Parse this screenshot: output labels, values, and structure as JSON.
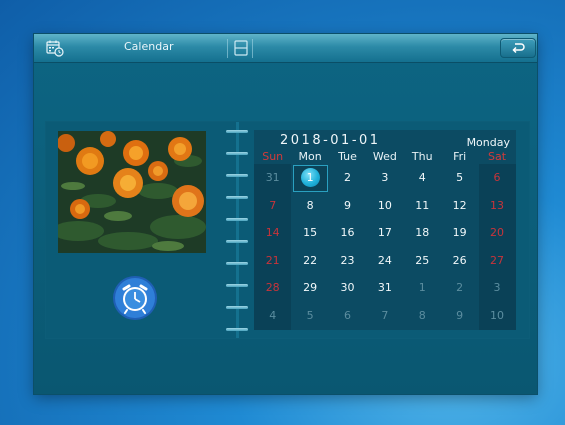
{
  "window": {
    "title": "Calendar"
  },
  "calendar": {
    "date": "2018-01-01",
    "weekday": "Monday",
    "day_headers": [
      "Sun",
      "Mon",
      "Tue",
      "Wed",
      "Thu",
      "Fri",
      "Sat"
    ],
    "weeks": [
      [
        "31",
        "1",
        "2",
        "3",
        "4",
        "5",
        "6"
      ],
      [
        "7",
        "8",
        "9",
        "10",
        "11",
        "12",
        "13"
      ],
      [
        "14",
        "15",
        "16",
        "17",
        "18",
        "19",
        "20"
      ],
      [
        "21",
        "22",
        "23",
        "24",
        "25",
        "26",
        "27"
      ],
      [
        "28",
        "29",
        "30",
        "31",
        "1",
        "2",
        "3"
      ],
      [
        "4",
        "5",
        "6",
        "7",
        "8",
        "9",
        "10"
      ]
    ],
    "selected_day": "1"
  },
  "icons": {
    "app": "calendar-clock-icon",
    "list": "list-view-icon",
    "back": "back-arrow-icon",
    "alarm": "alarm-clock-icon"
  },
  "colors": {
    "accent": "#1fb1da",
    "weekend": "#c8343a",
    "panel": "#0b5b76"
  }
}
